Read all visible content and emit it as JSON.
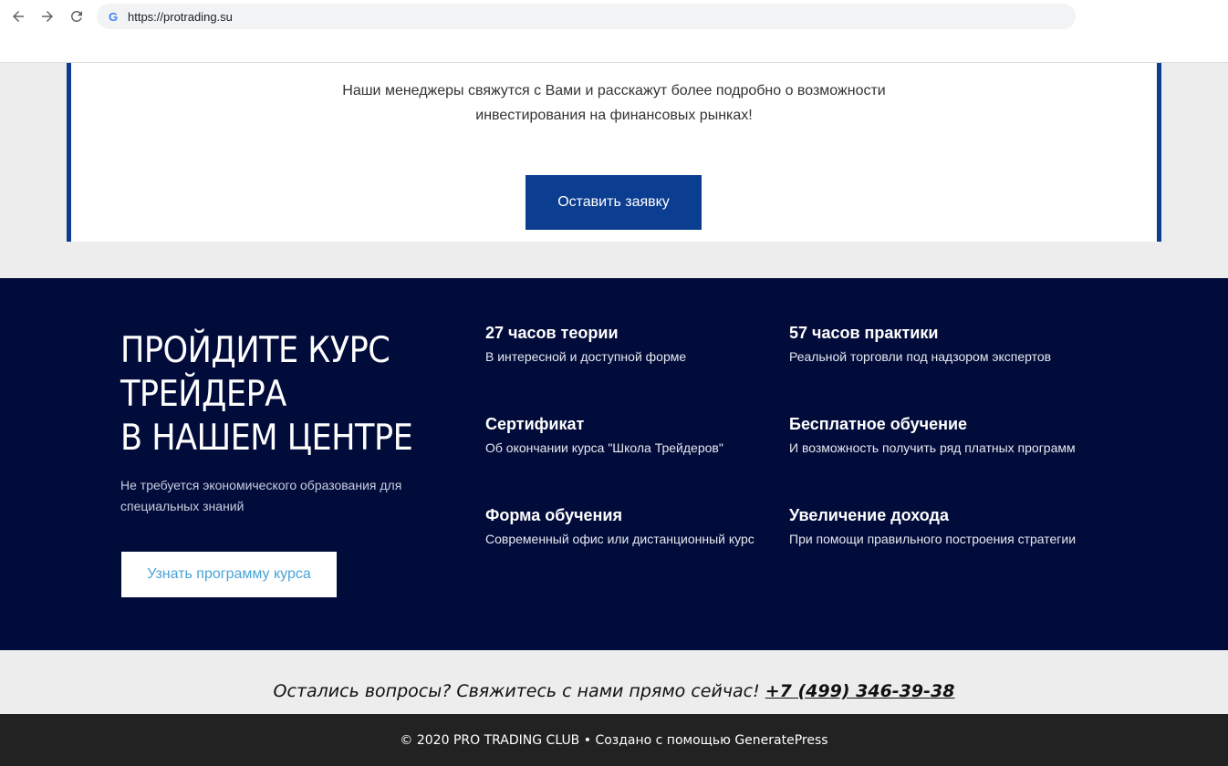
{
  "browser": {
    "url": "https://protrading.su",
    "google_icon": "G"
  },
  "cta": {
    "text_line1": "Наши менеджеры свяжутся с Вами и расскажут более подробно о возможности",
    "text_line2": "инвестирования на финансовых рынках!",
    "button_label": "Оставить заявку"
  },
  "course": {
    "title_line1": "ПРОЙДИТЕ КУРС",
    "title_line2": "ТРЕЙДЕРА",
    "title_line3": "В НАШЕМ ЦЕНТРЕ",
    "subtitle": "Не требуется экономического образования для специальных знаний",
    "button_label": "Узнать программу курса",
    "features": [
      {
        "title": "27 часов теории",
        "desc": "В интересной и доступной форме"
      },
      {
        "title": "57 часов практики",
        "desc": "Реальной торговли под надзором экспертов"
      },
      {
        "title": "Сертификат",
        "desc": "Об окончании курса \"Школа Трейдеров\""
      },
      {
        "title": "Бесплатное обучение",
        "desc": "И возможность получить ряд платных программ"
      },
      {
        "title": "Форма обучения",
        "desc": "Современный офис или дистанционный курс"
      },
      {
        "title": "Увеличение дохода",
        "desc": "При помощи правильного построения стратегии"
      }
    ]
  },
  "contact": {
    "text": "Остались вопросы? Свяжитесь с нами прямо сейчас!",
    "phone": "+7 (499) 346-39-38"
  },
  "footer": {
    "text": "© 2020 PRO TRADING CLUB • Создано с помощью GeneratePress"
  },
  "colors": {
    "brand_blue": "#0b3d91",
    "navy": "#020c3a",
    "link_blue": "#4aa3d8",
    "footer_bg": "#222222"
  }
}
